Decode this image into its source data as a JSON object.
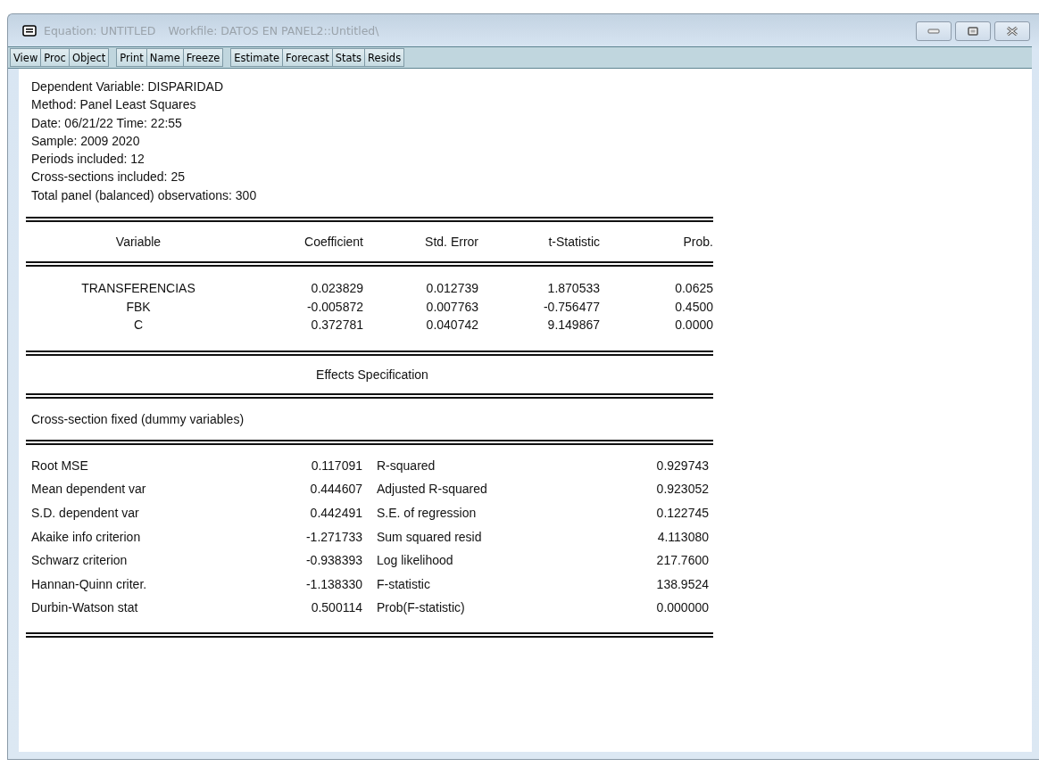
{
  "window": {
    "title": "Equation: UNTITLED",
    "subtitle": "Workfile: DATOS EN PANEL2::Untitled\\"
  },
  "toolbar": [
    [
      "View",
      "Proc",
      "Object"
    ],
    [
      "Print",
      "Name",
      "Freeze"
    ],
    [
      "Estimate",
      "Forecast",
      "Stats",
      "Resids"
    ]
  ],
  "header_lines": [
    "Dependent Variable: DISPARIDAD",
    "Method: Panel Least Squares",
    "Date: 06/21/22   Time: 22:55",
    "Sample: 2009 2020",
    "Periods included: 12",
    "Cross-sections included: 25",
    "Total panel (balanced) observations: 300"
  ],
  "coef_table": {
    "columns": [
      "Variable",
      "Coefficient",
      "Std. Error",
      "t-Statistic",
      "Prob."
    ],
    "rows": [
      [
        "TRANSFERENCIAS",
        "0.023829",
        "0.012739",
        "1.870533",
        "0.0625"
      ],
      [
        "FBK",
        "-0.005872",
        "0.007763",
        "-0.756477",
        "0.4500"
      ],
      [
        "C",
        "0.372781",
        "0.040742",
        "9.149867",
        "0.0000"
      ]
    ]
  },
  "effects_title": "Effects Specification",
  "effects_note": "Cross-section fixed (dummy variables)",
  "stats": [
    [
      "Root MSE",
      "0.117091",
      "R-squared",
      "0.929743"
    ],
    [
      "Mean dependent var",
      "0.444607",
      "Adjusted R-squared",
      "0.923052"
    ],
    [
      "S.D. dependent var",
      "0.442491",
      "S.E. of regression",
      "0.122745"
    ],
    [
      "Akaike info criterion",
      "-1.271733",
      "Sum squared resid",
      "4.113080"
    ],
    [
      "Schwarz criterion",
      "-0.938393",
      "Log likelihood",
      "217.7600"
    ],
    [
      "Hannan-Quinn criter.",
      "-1.138330",
      "F-statistic",
      "138.9524"
    ],
    [
      "Durbin-Watson stat",
      "0.500114",
      "Prob(F-statistic)",
      "0.000000"
    ]
  ]
}
